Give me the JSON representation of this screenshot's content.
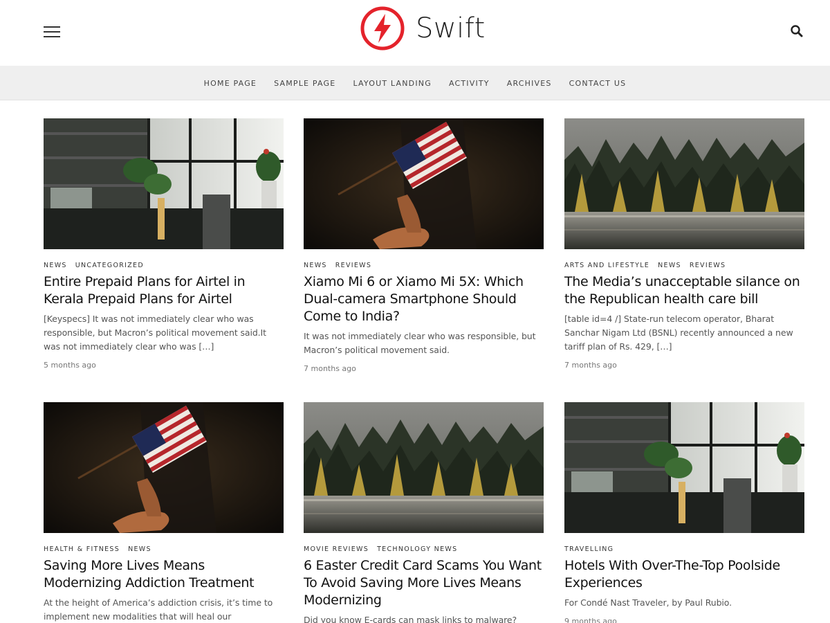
{
  "site": {
    "name": "Swift",
    "accent": "#e4232b"
  },
  "header": {
    "menu_icon": "hamburger-icon",
    "search_icon": "search-icon"
  },
  "nav": [
    "HOME PAGE",
    "SAMPLE PAGE",
    "LAYOUT LANDING",
    "ACTIVITY",
    "ARCHIVES",
    "CONTACT US"
  ],
  "posts": [
    {
      "image": "office-plants-image",
      "categories": [
        "NEWS",
        "UNCATEGORIZED"
      ],
      "title": "Entire Prepaid Plans for Airtel in Kerala Prepaid Plans for Airtel",
      "excerpt": "[Keyspecs] It was not immediately clear who was responsible, but Macron’s political movement said.It was not immediately clear who was […]",
      "date": "5 months ago"
    },
    {
      "image": "flag-hand-image",
      "categories": [
        "NEWS",
        "REVIEWS"
      ],
      "title": "Xiamo Mi 6 or Xiamo Mi 5X: Which Dual-camera Smartphone Should Come to India?",
      "excerpt": "It was not immediately clear who was responsible, but Macron’s political movement said.",
      "date": "7 months ago"
    },
    {
      "image": "forest-lake-image",
      "categories": [
        "ARTS AND LIFESTYLE",
        "NEWS",
        "REVIEWS"
      ],
      "title": "The Media’s unacceptable silance on the Republican health care bill",
      "excerpt": "[table id=4 /] State-run telecom operator, Bharat Sanchar Nigam Ltd (BSNL) recently announced a new tariff plan of Rs. 429, […]",
      "date": "7 months ago"
    },
    {
      "image": "flag-hand-image",
      "categories": [
        "HEALTH & FITNESS",
        "NEWS"
      ],
      "title": "Saving More Lives Means Modernizing Addiction Treatment",
      "excerpt": "At the height of America’s addiction crisis, it’s time to implement new modalities that will heal our",
      "date": ""
    },
    {
      "image": "forest-lake-image",
      "categories": [
        "MOVIE REVIEWS",
        "TECHNOLOGY NEWS"
      ],
      "title": "6 Easter Credit Card Scams You Want To Avoid Saving More Lives Means Modernizing",
      "excerpt": "Did you know E-cards can mask links to malware?",
      "date": ""
    },
    {
      "image": "office-plants-image",
      "categories": [
        "TRAVELLING"
      ],
      "title": "Hotels With Over-The-Top Poolside Experiences",
      "excerpt": "For Condé Nast Traveler, by Paul Rubio.",
      "date": "9 months ago"
    }
  ]
}
